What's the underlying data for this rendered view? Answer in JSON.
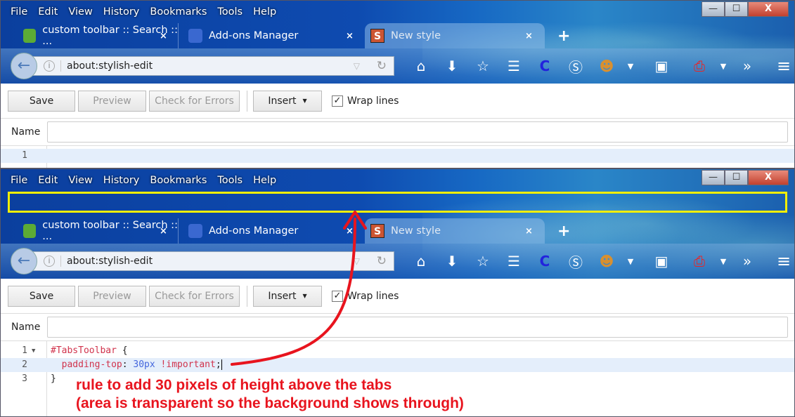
{
  "menu": [
    "File",
    "Edit",
    "View",
    "History",
    "Bookmarks",
    "Tools",
    "Help"
  ],
  "window_buttons": {
    "minimize": "—",
    "maximize": "☐",
    "close": "X"
  },
  "tabs": [
    {
      "label": "custom toolbar :: Search :: ...",
      "close": "×"
    },
    {
      "label": "Add-ons Manager",
      "close": "×"
    },
    {
      "label": "New style",
      "close": "×"
    }
  ],
  "new_tab": "+",
  "url": "about:stylish-edit",
  "toolbar_icons": [
    "home-icon",
    "download-icon",
    "bookmark-star-icon",
    "reading-list-icon",
    "cm-extension-icon",
    "stylish-s-icon",
    "greasemonkey-icon",
    "dropdown-icon",
    "stylish-box-icon",
    "pdf-icon",
    "dropdown-icon",
    "overflow-icon",
    "hamburger-menu-icon"
  ],
  "editor": {
    "save": "Save",
    "preview": "Preview",
    "check": "Check for Errors",
    "insert": "Insert",
    "wrap": "Wrap lines",
    "name_label": "Name",
    "name_value": ""
  },
  "code_top": [
    {
      "n": "1",
      "text": ""
    }
  ],
  "code_bottom": [
    {
      "n": "1",
      "sel": "#TabsToolbar",
      "rest": " {"
    },
    {
      "n": "2",
      "prop": "  padding-top",
      "colon": ": ",
      "num": "30px",
      "imp": " !important",
      "semi": ";"
    },
    {
      "n": "3",
      "rest": "}"
    }
  ],
  "annotation": [
    "rule to add 30 pixels of height above the tabs",
    "(area is transparent so the background shows through)"
  ],
  "colors": {
    "annotation": "#e8141e",
    "highlight": "#f3ee00",
    "chrome": "#0b3f9e"
  }
}
